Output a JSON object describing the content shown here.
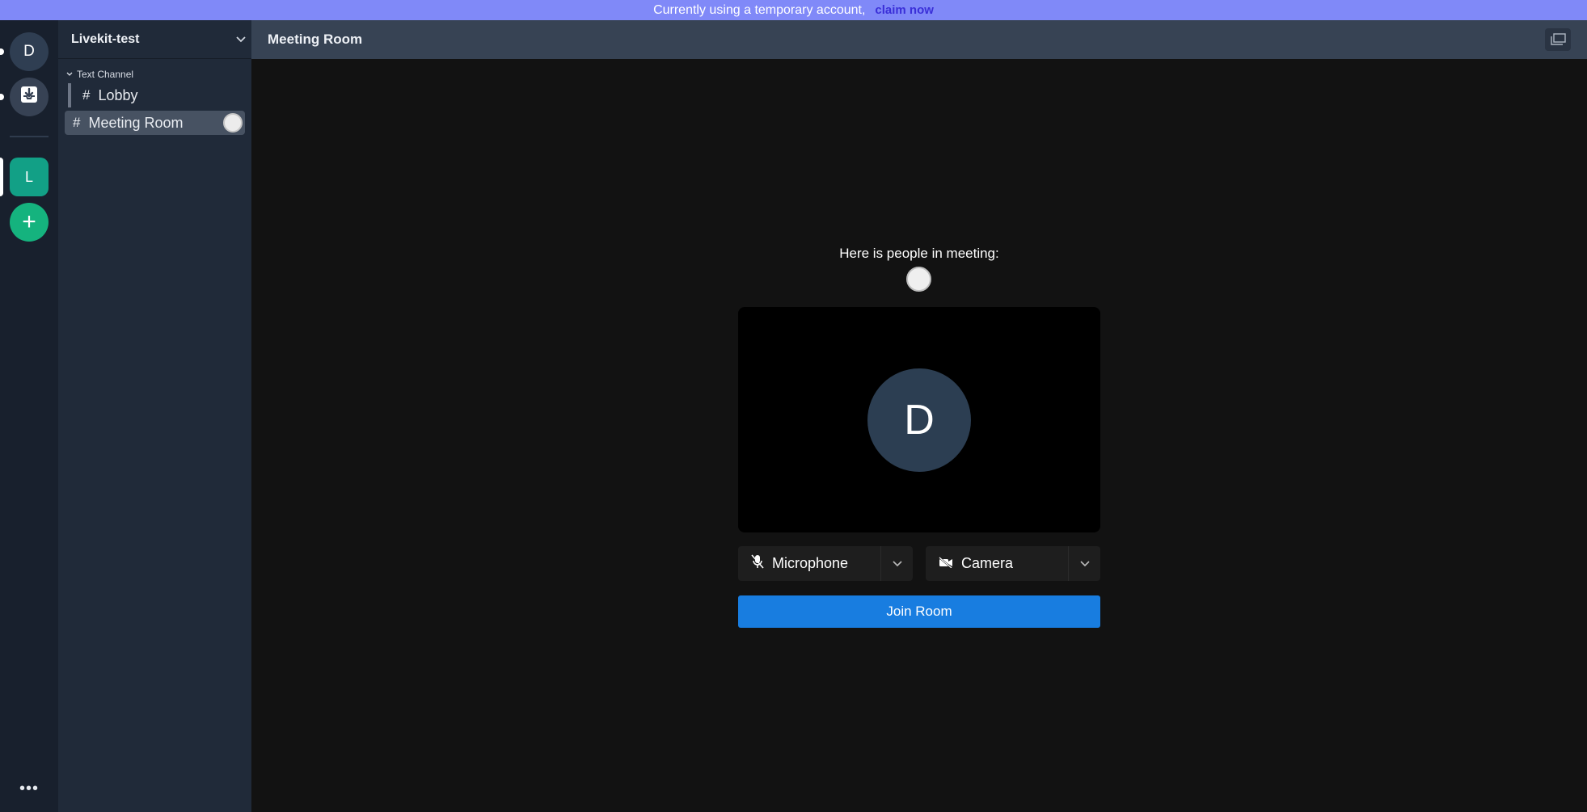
{
  "banner": {
    "text": "Currently using a temporary account,",
    "link": "claim now"
  },
  "rail": {
    "avatar_letter": "D",
    "server_letter": "L",
    "add_symbol": "+",
    "more_symbol": "•••"
  },
  "sidebar": {
    "server_name": "Livekit-test",
    "section_label": "Text Channel",
    "channels": [
      {
        "label": "Lobby",
        "hash": "#"
      },
      {
        "label": "Meeting Room",
        "hash": "#"
      }
    ]
  },
  "main": {
    "title": "Meeting Room",
    "people_text": "Here is people in meeting:",
    "preview_letter": "D",
    "microphone_label": "Microphone",
    "camera_label": "Camera",
    "join_label": "Join Room"
  },
  "colors": {
    "banner": "#8089f8",
    "accent": "#187de0",
    "server": "#12a086",
    "add": "#15b37e"
  }
}
